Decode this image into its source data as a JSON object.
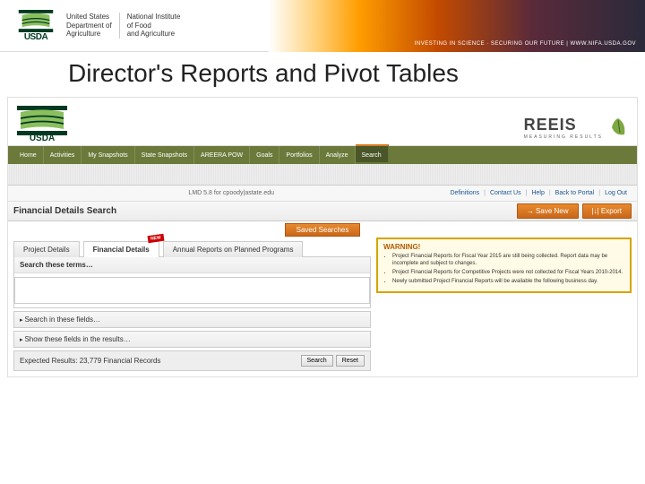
{
  "header": {
    "usda": "USDA",
    "dept1": "United States",
    "dept2": "Department of",
    "dept3": "Agriculture",
    "nifa1": "National Institute",
    "nifa2": "of Food",
    "nifa3": "and Agriculture",
    "tagline": "INVESTING IN SCIENCE · SECURING OUR FUTURE | WWW.NIFA.USDA.GOV"
  },
  "slide_title": "Director's Reports and Pivot Tables",
  "app": {
    "reeis": "REEIS",
    "reeis_sub": "MEASURING RESULTS",
    "nav": [
      "Home",
      "Activities",
      "My Snapshots",
      "State Snapshots",
      "AREERA POW",
      "Goals",
      "Portfolios",
      "Analyze",
      "Search"
    ],
    "nav_active": 8,
    "user_line": "LMD 5.8 for cpoody|astate.edu",
    "util_links": [
      "Definitions",
      "Contact Us",
      "Help",
      "Back to Portal",
      "Log Out"
    ],
    "section_title": "Financial Details Search",
    "btn_save": "→ Save New",
    "btn_export": "|↓| Export",
    "saved_searches": "Saved Searches",
    "tabs": [
      "Project Details",
      "Financial Details",
      "Annual Reports on Planned Programs"
    ],
    "active_tab": 1,
    "new_badge": "NEW",
    "panel_search": "Search these terms…",
    "panel_fields": "Search in these fields…",
    "panel_show": "Show these fields in the results…",
    "results_label": "Expected Results: 23,779 Financial Records",
    "btn_search": "Search",
    "btn_reset": "Reset",
    "warning_title": "WARNING!",
    "warnings": [
      "Project Financial Reports for Fiscal Year 2015 are still being collected. Report data may be incomplete and subject to changes.",
      "Project Financial Reports for Competitive Projects were not collected for Fiscal Years 2010-2014.",
      "Newly submitted Project Financial Reports will be available the following business day."
    ]
  }
}
